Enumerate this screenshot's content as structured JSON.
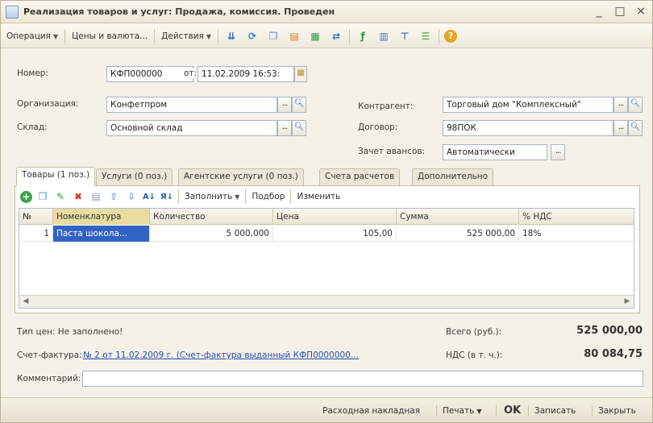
{
  "window": {
    "title": "Реализация товаров и услуг: Продажа, комиссия. Проведен",
    "controls": [
      "_",
      "□",
      "×"
    ]
  },
  "toolbar": {
    "operation": "Операция",
    "prices": "Цены и валюта...",
    "actions": "Действия",
    "icons": [
      "down-arrow-icon",
      "refresh-icon",
      "copy-icon",
      "doc-structure-icon",
      "doc-green-icon",
      "movement-icon",
      "dt-kt-icon",
      "report-icon",
      "structure-icon",
      "list-icon",
      "help-icon"
    ]
  },
  "form": {
    "number_label": "Номер:",
    "number_value": "КФП000000",
    "from_label": "от:",
    "date_value": "11.02.2009 16:53:",
    "org_label": "Организация:",
    "org_value": "Конфетпром",
    "warehouse_label": "Склад:",
    "warehouse_value": "Основной склад",
    "counterparty_label": "Контрагент:",
    "counterparty_value": "Торговый дом \"Комплексный\"",
    "contract_label": "Договор:",
    "contract_value": "98ПОК",
    "offset_label": "Зачет авансов:",
    "offset_value": "Автоматически"
  },
  "tabs": [
    {
      "label": "Товары (1 поз.)",
      "active": true
    },
    {
      "label": "Услуги (0 поз.)",
      "active": false
    },
    {
      "label": "Агентские услуги (0 поз.)",
      "active": false
    },
    {
      "label": "Счета расчетов",
      "active": false
    },
    {
      "label": "Дополнительно",
      "active": false
    }
  ],
  "subtoolbar": {
    "fill": "Заполнить",
    "select": "Подбор",
    "change": "Изменить"
  },
  "table": {
    "columns": [
      "№",
      "Номенклатура",
      "Количество",
      "Цена",
      "Сумма",
      "% НДС"
    ],
    "rows": [
      {
        "n": "1",
        "item": "Паста шокола...",
        "qty": "5 000,000",
        "price": "105,00",
        "sum": "525 000,00",
        "vat": "18%"
      }
    ]
  },
  "info": {
    "price_type": "Тип цен: Не заполнено!",
    "invoice_label": "Счет-фактура:",
    "invoice_link": "№ 2 от 11.02.2009 г. (Счет-фактура выданный КФП0000000...",
    "comment_label": "Комментарий:",
    "comment_value": "",
    "total_label": "Всего (руб.):",
    "total_value": "525 000,00",
    "vat_label": "НДС (в т. ч.):",
    "vat_value": "80 084,75"
  },
  "footer": {
    "waybill": "Расходная накладная",
    "print": "Печать",
    "ok": "OK",
    "save": "Записать",
    "close": "Закрыть"
  }
}
